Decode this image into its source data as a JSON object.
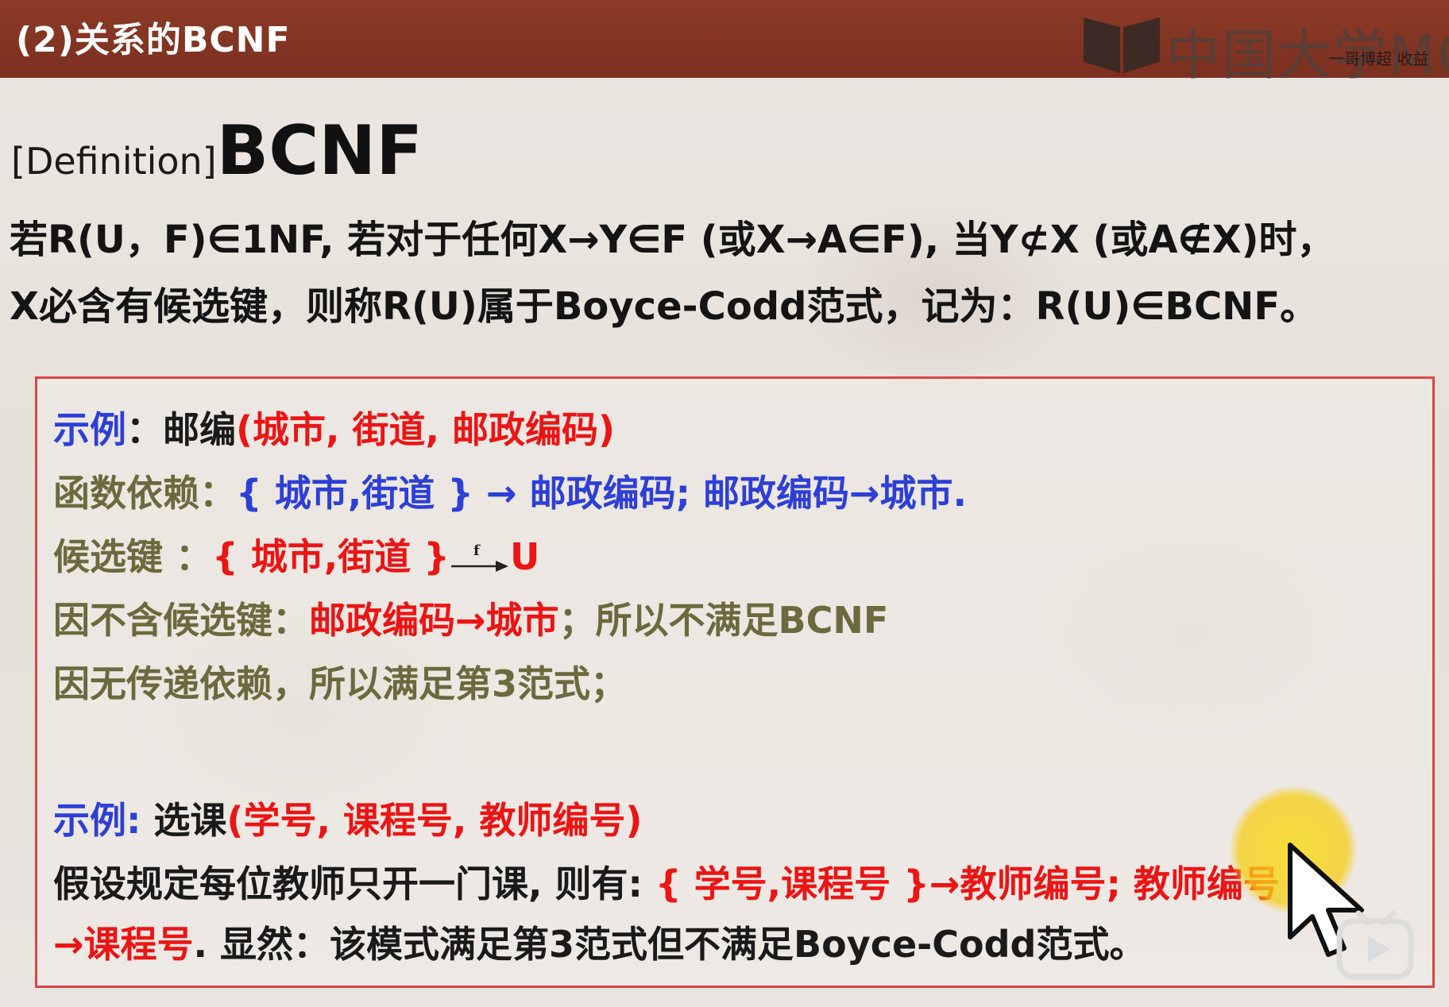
{
  "header": {
    "title": "(2)关系的BCNF",
    "logo_text": "中国大学MO",
    "logo_sub": "一哥博超 收益"
  },
  "definition": {
    "prefix": "[Definition]",
    "term": "BCNF",
    "line1": "若R(U，F)∈1NF, 若对于任何X→Y∈F (或X→A∈F), 当Y⊄X (或A∉X)时，",
    "line2": "X必含有候选键，则称R(U)属于Boyce-Codd范式，记为：R(U)∈BCNF。"
  },
  "example1": {
    "label": "示例",
    "colon": "：",
    "relation_name": "邮编",
    "relation_attrs": "(城市, 街道, 邮政编码)",
    "fd_label": "函数依赖：",
    "fd_value": "{ 城市,街道 } → 邮政编码; 邮政编码→城市.",
    "key_label": "候选键  ：",
    "key_value": "{ 城市,街道 }",
    "key_arrow_label": "f",
    "key_target": "U",
    "reason1_prefix": "因不含候选键：",
    "reason1_fd": "邮政编码→城市",
    "reason1_suffix": "；所以不满足BCNF",
    "reason2": "因无传递依赖，所以满足第3范式；"
  },
  "example2": {
    "label": "示例:",
    "relation_name": " 选课",
    "relation_attrs": "(学号, 课程号, 教师编号)",
    "assume_prefix": "假设规定每位教师只开一门课, 则有:",
    "assume_fd": " { 学号,课程号 }→教师编号; 教师编号",
    "line3_fd": "→课程号",
    "line3_suffix": ". 显然：该模式满足第3范式但不满足Boyce-Codd范式。"
  }
}
